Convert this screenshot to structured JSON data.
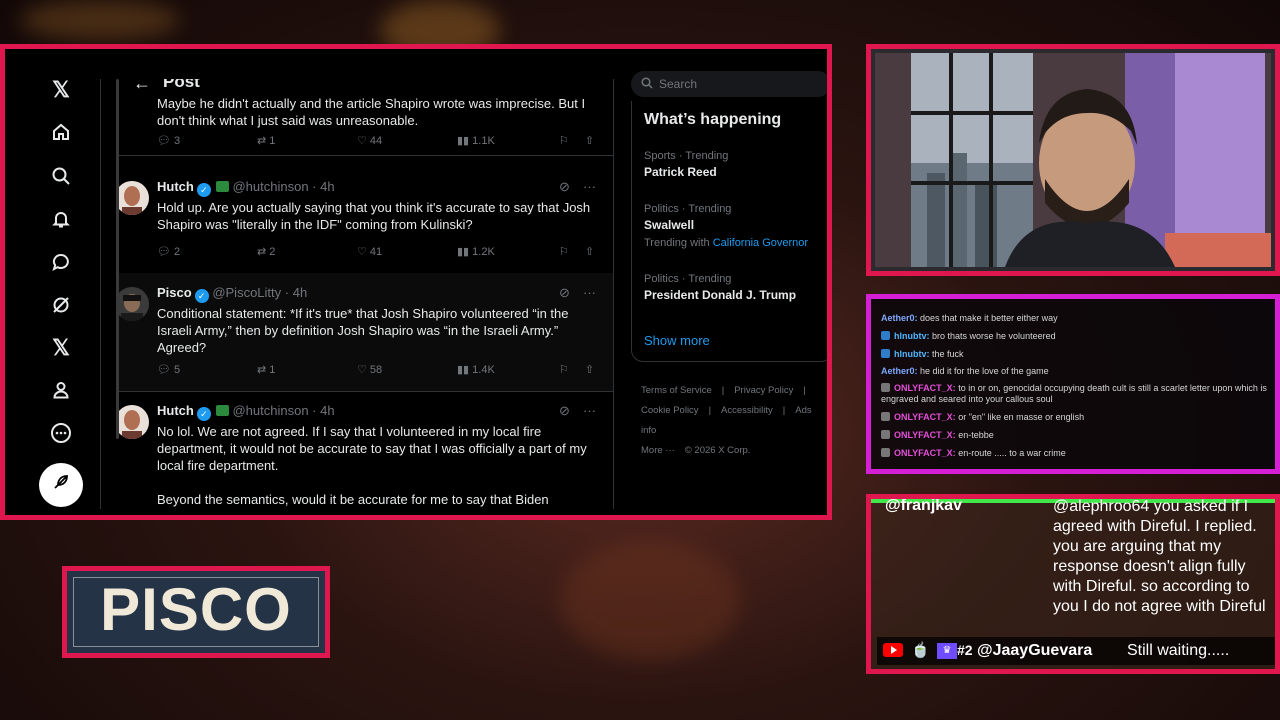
{
  "nav": {
    "icons": [
      "x-logo-icon",
      "home-icon",
      "search-icon",
      "bell-icon",
      "messages-icon",
      "grok-icon",
      "premium-x-icon",
      "profile-icon",
      "more-icon"
    ],
    "post_button_icon": "feather-icon"
  },
  "header": {
    "back_icon": "←",
    "title": "Post"
  },
  "partial_tweet": {
    "text": "Maybe he didn't actually and the article Shapiro wrote was imprecise. But I don't think what I just said was unreasonable.",
    "replies": "3",
    "reposts": "1",
    "likes": "44",
    "views": "1.1K"
  },
  "tweets": [
    {
      "name": "Hutch",
      "handle": "@hutchinson",
      "dot": "·",
      "time": "4h",
      "text": "Hold up. Are you actually saying that you think it's accurate to say that Josh Shapiro was \"literally in the IDF\" coming from Kulinski?",
      "replies": "2",
      "reposts": "2",
      "likes": "41",
      "views": "1.2K"
    },
    {
      "name": "Pisco",
      "handle": "@PiscoLitty",
      "dot": "·",
      "time": "4h",
      "text": "Conditional statement: *If it's true* that Josh Shapiro volunteered “in the Israeli Army,” then by definition Josh Shapiro was “in the Israeli Army.” Agreed?",
      "replies": "5",
      "reposts": "1",
      "likes": "58",
      "views": "1.4K"
    },
    {
      "name": "Hutch",
      "handle": "@hutchinson",
      "dot": "·",
      "time": "4h",
      "text": "No lol. We are not agreed. If I say that I volunteered in my local fire department, it would not be accurate to say that I was officially a part of my local fire department.",
      "text2": "Beyond the semantics, would it be accurate for me to say that Biden"
    }
  ],
  "sidebar": {
    "search_placeholder": "Search",
    "trends_title": "What’s happening",
    "trends": [
      {
        "meta": "Sports · Trending",
        "name": "Patrick Reed",
        "with_label": "",
        "with_link": ""
      },
      {
        "meta": "Politics · Trending",
        "name": "Swalwell",
        "with_label": "Trending with",
        "with_link": "California Governor"
      },
      {
        "meta": "Politics · Trending",
        "name": "President Donald J. Trump",
        "with_label": "",
        "with_link": ""
      }
    ],
    "show_more": "Show more",
    "footer": [
      "Terms of Service",
      "|",
      "Privacy Policy",
      "|",
      "Cookie Policy",
      "|",
      "Accessibility",
      "|",
      "Ads info",
      "More ···",
      "© 2026 X Corp."
    ]
  },
  "chat": [
    {
      "user": "Aether0:",
      "text": "does that make it better either way",
      "color": "#7ea8ff",
      "badge": ""
    },
    {
      "user": "hlnubtv:",
      "text": "bro thats worse he volunteered",
      "color": "#4fb6ff",
      "badge": "#2f7cc9"
    },
    {
      "user": "hlnubtv:",
      "text": "the fuck",
      "color": "#4fb6ff",
      "badge": "#2f7cc9"
    },
    {
      "user": "Aether0:",
      "text": "he did it for the love of the game",
      "color": "#7ea8ff",
      "badge": ""
    },
    {
      "user": "ONLYFACT_X:",
      "text": "to in or on, genocidal occupying death cult is still a scarlet letter upon which is engraved and seared into your callous soul",
      "color": "#e44fd8",
      "badge": "#777777"
    },
    {
      "user": "ONLYFACT_X:",
      "text": "or \"en\" like en masse or english",
      "color": "#e44fd8",
      "badge": "#777777"
    },
    {
      "user": "ONLYFACT_X:",
      "text": "en-tebbe",
      "color": "#e44fd8",
      "badge": "#777777"
    },
    {
      "user": "ONLYFACT_X:",
      "text": "en-route ..... to a war crime",
      "color": "#e44fd8",
      "badge": "#777777"
    }
  ],
  "featured_message": {
    "top_user": "@franjkav",
    "top_text": "@alephroo64 you asked if I agreed with Direful. I replied. you are arguing that my response doesn't align fully with Direful. so according to you I do not agree with Direful",
    "rank": "#2",
    "user": "@JaayGuevara",
    "text": "Still waiting....."
  },
  "nameplate": {
    "text": "PISCO"
  },
  "colors": {
    "frame": "#e0164f",
    "chat_frame": "#d51fd4",
    "x_blue": "#1d9bf0"
  }
}
